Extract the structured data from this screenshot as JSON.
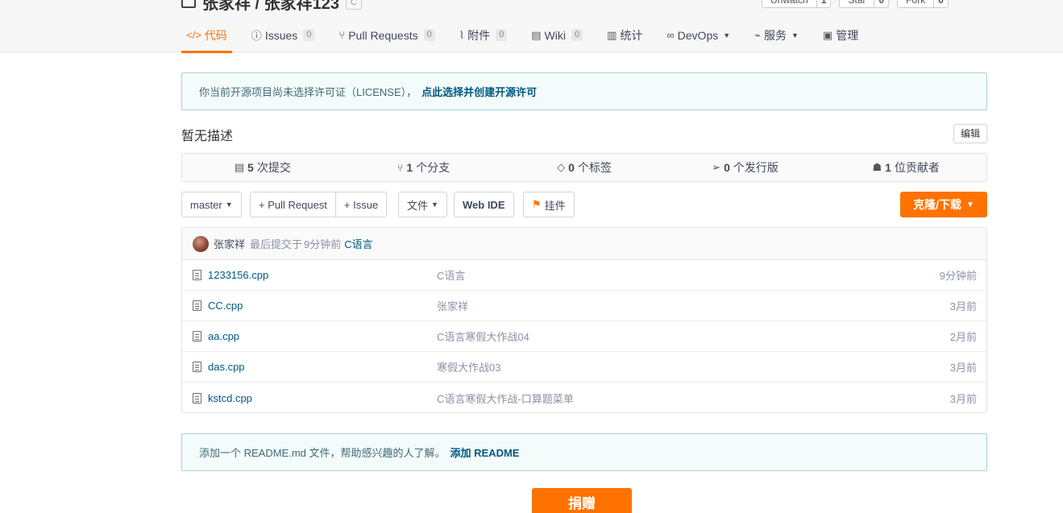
{
  "repo": {
    "title": "张家祥 / 张家祥123",
    "lang_badge": "C"
  },
  "top_actions": [
    {
      "label": "Unwatch",
      "count": "1"
    },
    {
      "label": "Star",
      "count": "0"
    },
    {
      "label": "Fork",
      "count": "0"
    }
  ],
  "nav": {
    "code": "代码",
    "issues": "Issues",
    "issues_count": "0",
    "pull_requests": "Pull Requests",
    "pull_requests_count": "0",
    "attachments": "附件",
    "attachments_count": "0",
    "wiki": "Wiki",
    "wiki_count": "0",
    "stats": "统计",
    "devops": "DevOps",
    "services": "服务",
    "manage": "管理"
  },
  "license_notice": {
    "text": "你当前开源项目尚未选择许可证（LICENSE），",
    "link": "点此选择并创建开源许可"
  },
  "description": "暂无描述",
  "edit_label": "编辑",
  "stats": {
    "commits_num": "5",
    "commits_label": "次提交",
    "branches_num": "1",
    "branches_label": "个分支",
    "tags_num": "0",
    "tags_label": "个标签",
    "releases_num": "0",
    "releases_label": "个发行版",
    "contributors_num": "1",
    "contributors_label": "位贡献者"
  },
  "toolbar": {
    "branch": "master",
    "pull_request": "+ Pull Request",
    "issue": "+ Issue",
    "file": "文件",
    "web_ide": "Web IDE",
    "widget": "挂件",
    "clone": "克隆/下载"
  },
  "last_commit": {
    "author": "张家祥",
    "prefix": "最后提交于",
    "time": "9分钟前",
    "message": "C语言"
  },
  "files": [
    {
      "name": "1233156.cpp",
      "message": "C语言",
      "time": "9分钟前"
    },
    {
      "name": "CC.cpp",
      "message": "张家祥",
      "time": "3月前"
    },
    {
      "name": "aa.cpp",
      "message": "C语言寒假大作战04",
      "time": "2月前"
    },
    {
      "name": "das.cpp",
      "message": "寒假大作战03",
      "time": "3月前"
    },
    {
      "name": "kstcd.cpp",
      "message": "C语言寒假大作战-口算题菜单",
      "time": "3月前"
    }
  ],
  "readme_notice": {
    "text": "添加一个 README.md 文件，帮助感兴趣的人了解。",
    "link": "添加 README"
  },
  "donate": "捐赠",
  "colors": {
    "accent": "#fe7300",
    "link": "#005980",
    "notice_border": "#a7d2d6"
  }
}
